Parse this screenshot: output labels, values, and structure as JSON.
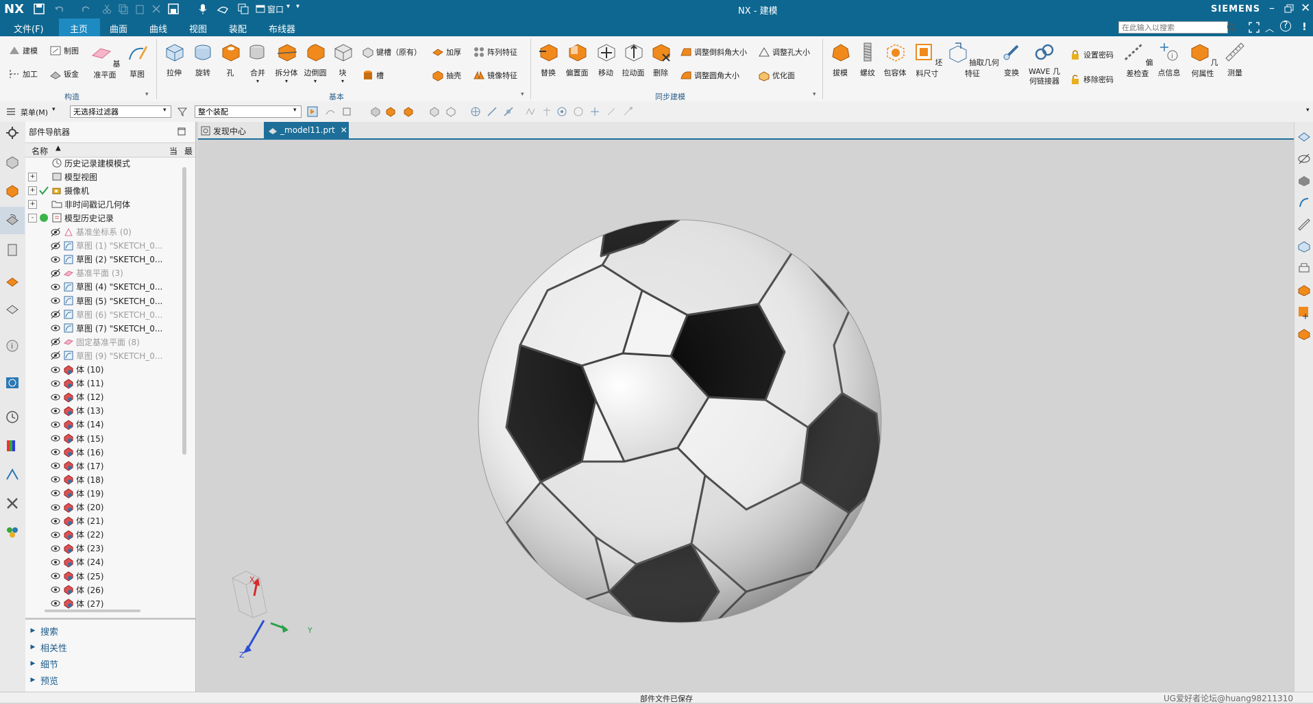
{
  "title_bar": {
    "logo": "NX",
    "window_title": "NX - 建模",
    "brand": "SIEMENS",
    "window_menu": "窗口"
  },
  "menu": {
    "file": "文件(F)",
    "tabs": [
      "主页",
      "曲面",
      "曲线",
      "视图",
      "装配",
      "布线器"
    ],
    "active_tab": "主页",
    "search_placeholder": "在此输入以搜索"
  },
  "ribbon": {
    "construct": {
      "label": "构造",
      "items": [
        "建模",
        "制图",
        "加工",
        "钣金",
        "基准平面",
        "草图"
      ]
    },
    "basic": {
      "label": "基本",
      "items": [
        "拉伸",
        "旋转",
        "孔",
        "合并",
        "拆分体",
        "边倒圆",
        "块",
        "键槽（原有）",
        "槽",
        "加厚",
        "阵列特征",
        "抽壳",
        "镜像特征"
      ]
    },
    "sync": {
      "label": "同步建模",
      "items": [
        "替换",
        "偏置面",
        "移动",
        "拉动面",
        "删除",
        "调整倒斜角大小",
        "调整孔大小",
        "调整圆角大小",
        "优化面"
      ]
    },
    "more": {
      "items": [
        "拔模",
        "螺纹",
        "包容体",
        "坯料尺寸",
        "抽取几何特征",
        "变换",
        "WAVE 几何链接器",
        "设置密码",
        "移除密码",
        "偏差检查",
        "点信息",
        "几何属性",
        "测量"
      ]
    }
  },
  "toolbar2": {
    "menu_label": "菜单(M)",
    "filter_value": "无选择过滤器",
    "assembly_value": "整个装配"
  },
  "navigator": {
    "title": "部件导航器",
    "columns": [
      "名称",
      "当",
      "最"
    ],
    "rows": [
      {
        "text": "历史记录建模模式",
        "indent": 1,
        "icon": "clock",
        "dim": false,
        "expander": ""
      },
      {
        "text": "模型视图",
        "indent": 1,
        "icon": "view",
        "dim": false,
        "expander": "+"
      },
      {
        "text": "摄像机",
        "indent": 1,
        "icon": "camera",
        "dim": false,
        "expander": "+"
      },
      {
        "text": "非时间戳记几何体",
        "indent": 1,
        "icon": "folder",
        "dim": false,
        "expander": "+"
      },
      {
        "text": "模型历史记录",
        "indent": 1,
        "icon": "history",
        "dim": false,
        "expander": "-"
      },
      {
        "text": "基准坐标系 (0)",
        "indent": 2,
        "icon": "csys",
        "dim": true
      },
      {
        "text": "草图 (1) \"SKETCH_0...",
        "indent": 2,
        "icon": "sketch",
        "dim": true
      },
      {
        "text": "草图 (2) \"SKETCH_0...",
        "indent": 2,
        "icon": "sketch",
        "dim": false
      },
      {
        "text": "基准平面 (3)",
        "indent": 2,
        "icon": "plane",
        "dim": true
      },
      {
        "text": "草图 (4) \"SKETCH_0...",
        "indent": 2,
        "icon": "sketch",
        "dim": false
      },
      {
        "text": "草图 (5) \"SKETCH_0...",
        "indent": 2,
        "icon": "sketch",
        "dim": false
      },
      {
        "text": "草图 (6) \"SKETCH_0...",
        "indent": 2,
        "icon": "sketch",
        "dim": true
      },
      {
        "text": "草图 (7) \"SKETCH_0...",
        "indent": 2,
        "icon": "sketch",
        "dim": false
      },
      {
        "text": "固定基准平面 (8)",
        "indent": 2,
        "icon": "plane",
        "dim": true
      },
      {
        "text": "草图 (9) \"SKETCH_0...",
        "indent": 2,
        "icon": "sketch",
        "dim": true
      },
      {
        "text": "体 (10)",
        "indent": 2,
        "icon": "body",
        "dim": false
      },
      {
        "text": "体 (11)",
        "indent": 2,
        "icon": "body",
        "dim": false
      },
      {
        "text": "体 (12)",
        "indent": 2,
        "icon": "body",
        "dim": false
      },
      {
        "text": "体 (13)",
        "indent": 2,
        "icon": "body",
        "dim": false
      },
      {
        "text": "体 (14)",
        "indent": 2,
        "icon": "body",
        "dim": false
      },
      {
        "text": "体 (15)",
        "indent": 2,
        "icon": "body",
        "dim": false
      },
      {
        "text": "体 (16)",
        "indent": 2,
        "icon": "body",
        "dim": false
      },
      {
        "text": "体 (17)",
        "indent": 2,
        "icon": "body",
        "dim": false
      },
      {
        "text": "体 (18)",
        "indent": 2,
        "icon": "body",
        "dim": false
      },
      {
        "text": "体 (19)",
        "indent": 2,
        "icon": "body",
        "dim": false
      },
      {
        "text": "体 (20)",
        "indent": 2,
        "icon": "body",
        "dim": false
      },
      {
        "text": "体 (21)",
        "indent": 2,
        "icon": "body",
        "dim": false
      },
      {
        "text": "体 (22)",
        "indent": 2,
        "icon": "body",
        "dim": false
      },
      {
        "text": "体 (23)",
        "indent": 2,
        "icon": "body",
        "dim": false
      },
      {
        "text": "体 (24)",
        "indent": 2,
        "icon": "body",
        "dim": false
      },
      {
        "text": "体 (25)",
        "indent": 2,
        "icon": "body",
        "dim": false
      },
      {
        "text": "体 (26)",
        "indent": 2,
        "icon": "body",
        "dim": false
      },
      {
        "text": "体 (27)",
        "indent": 2,
        "icon": "body",
        "dim": false
      }
    ],
    "panels": [
      "搜索",
      "相关性",
      "细节",
      "预览"
    ]
  },
  "doc_tabs": [
    {
      "label": "发现中心",
      "active": false
    },
    {
      "label": "_model11.prt",
      "active": true
    }
  ],
  "triad": {
    "x": "X",
    "y": "Y",
    "z": "Z"
  },
  "status": {
    "message": "部件文件已保存",
    "watermark": "UG爱好者论坛@huang98211310"
  },
  "colors": {
    "titlebar": "#0e6790",
    "accent_orange": "#f08a1c",
    "active_tab_bg": "#1d6f99"
  }
}
